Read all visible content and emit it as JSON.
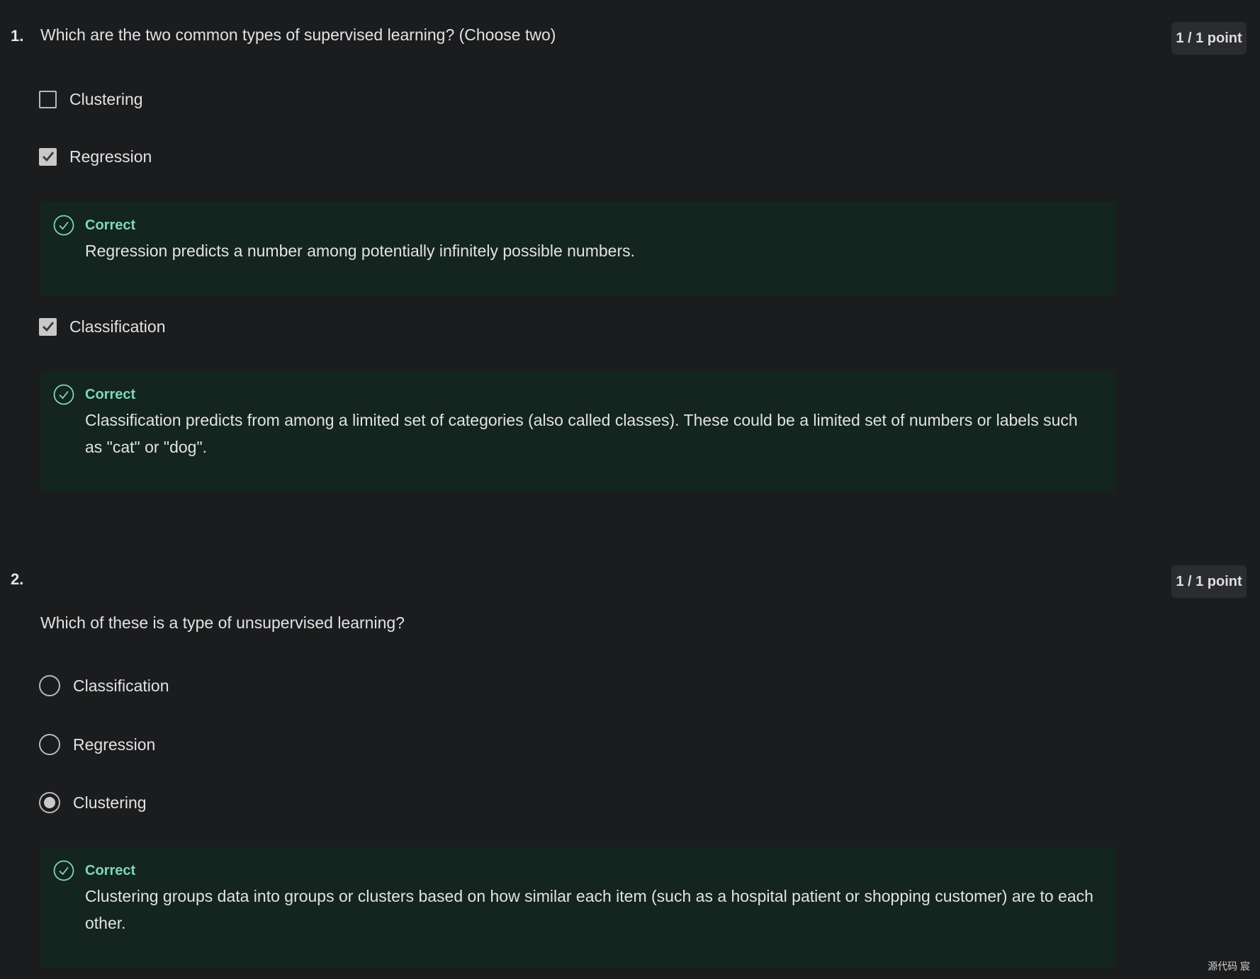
{
  "questions": [
    {
      "number": "1.",
      "text": "Which are the two common types of supervised learning? (Choose two)",
      "points": "1 / 1 point",
      "type": "checkbox",
      "options": [
        {
          "label": "Clustering",
          "checked": false
        },
        {
          "label": "Regression",
          "checked": true,
          "feedback_title": "Correct",
          "feedback_text": "Regression predicts a number among potentially infinitely possible numbers."
        },
        {
          "label": "Classification",
          "checked": true,
          "feedback_title": "Correct",
          "feedback_text": "Classification predicts from among a limited set of categories (also called classes). These could be a limited set of numbers or labels such as \"cat\" or \"dog\"."
        }
      ]
    },
    {
      "number": "2.",
      "text": "Which of these is a type of unsupervised learning?",
      "points": "1 / 1 point",
      "type": "radio",
      "options": [
        {
          "label": "Classification",
          "selected": false
        },
        {
          "label": "Regression",
          "selected": false
        },
        {
          "label": "Clustering",
          "selected": true,
          "feedback_title": "Correct",
          "feedback_text": "Clustering groups data into groups or clusters based on how similar each item (such as a hospital patient or shopping customer) are to each other."
        }
      ]
    }
  ],
  "footer": "源代码  宸",
  "colors": {
    "background": "#1b1c1e",
    "feedback_bg": "#14241f",
    "correct_accent": "#7ed9b3",
    "points_badge": "#2b2c2f"
  }
}
